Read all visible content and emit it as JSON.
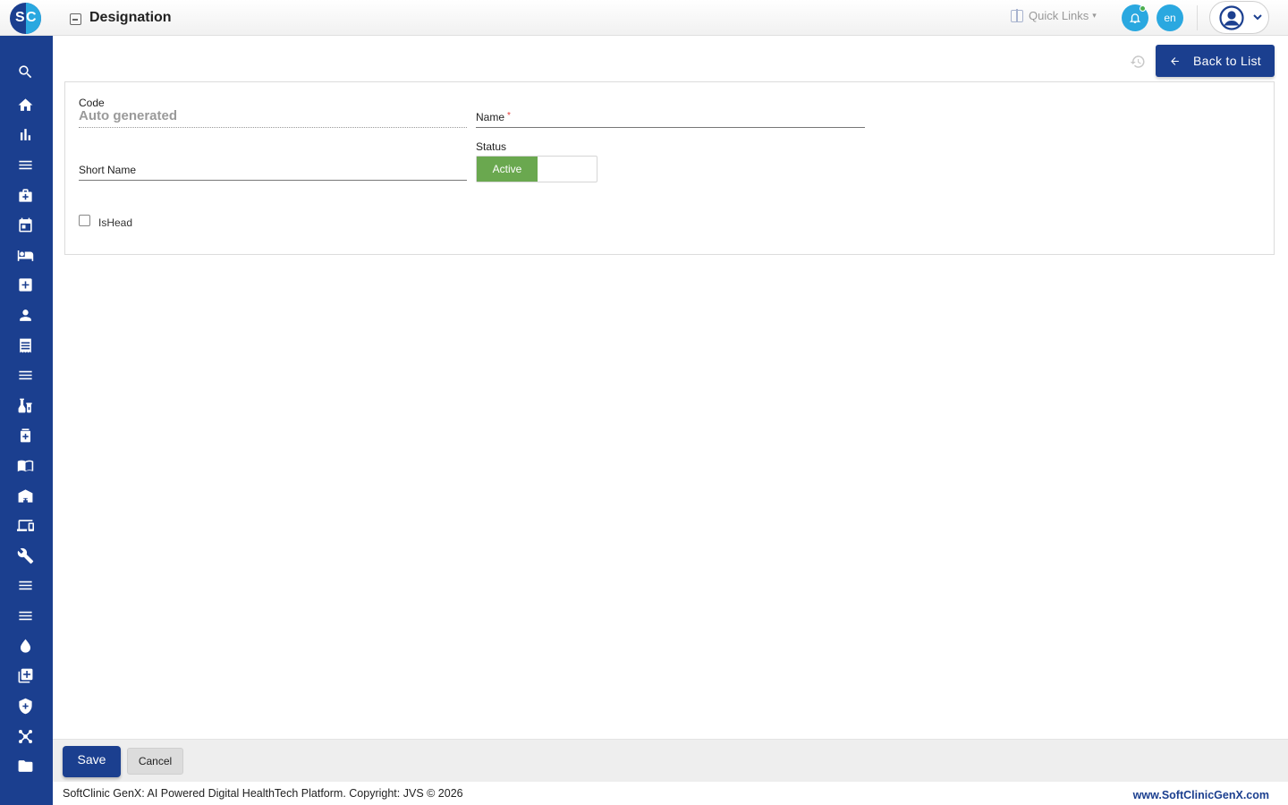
{
  "header": {
    "logo_s": "S",
    "logo_c": "C",
    "page_title": "Designation",
    "quick_links_label": "Quick Links",
    "language": "en"
  },
  "sidebar": {
    "items": [
      {
        "icon": "search-icon"
      },
      {
        "icon": "home-icon"
      },
      {
        "icon": "bar-chart-icon"
      },
      {
        "icon": "menu-icon"
      },
      {
        "icon": "medical-bag-icon"
      },
      {
        "icon": "calendar-icon"
      },
      {
        "icon": "bed-icon"
      },
      {
        "icon": "medical-cross-icon"
      },
      {
        "icon": "person-icon"
      },
      {
        "icon": "receipt-icon"
      },
      {
        "icon": "menu-icon"
      },
      {
        "icon": "lab-vials-icon"
      },
      {
        "icon": "pharmacy-icon"
      },
      {
        "icon": "book-icon"
      },
      {
        "icon": "store-icon"
      },
      {
        "icon": "devices-icon"
      },
      {
        "icon": "wrench-icon"
      },
      {
        "icon": "menu-icon"
      },
      {
        "icon": "menu-icon"
      },
      {
        "icon": "blood-drop-icon"
      },
      {
        "icon": "add-box-icon"
      },
      {
        "icon": "shield-icon"
      },
      {
        "icon": "network-icon"
      },
      {
        "icon": "folder-icon"
      }
    ]
  },
  "toolbar": {
    "back_label": "Back to List"
  },
  "form": {
    "code_label": "Code",
    "code_value": "Auto generated",
    "name_label": "Name",
    "name_required": "*",
    "name_value": "",
    "short_name_label": "Short Name",
    "short_name_value": "",
    "status_label": "Status",
    "status_value": "Active",
    "ishead_label": "IsHead",
    "ishead_checked": false
  },
  "footer": {
    "save_label": "Save",
    "cancel_label": "Cancel",
    "copyright": "SoftClinic GenX: AI Powered Digital HealthTech Platform. Copyright: JVS © 2026",
    "website": "www.SoftClinicGenX.com"
  },
  "colors": {
    "primary": "#1b3f8f",
    "accent": "#2aa8e0",
    "status_active": "#6aa84f",
    "required": "#e53935"
  }
}
